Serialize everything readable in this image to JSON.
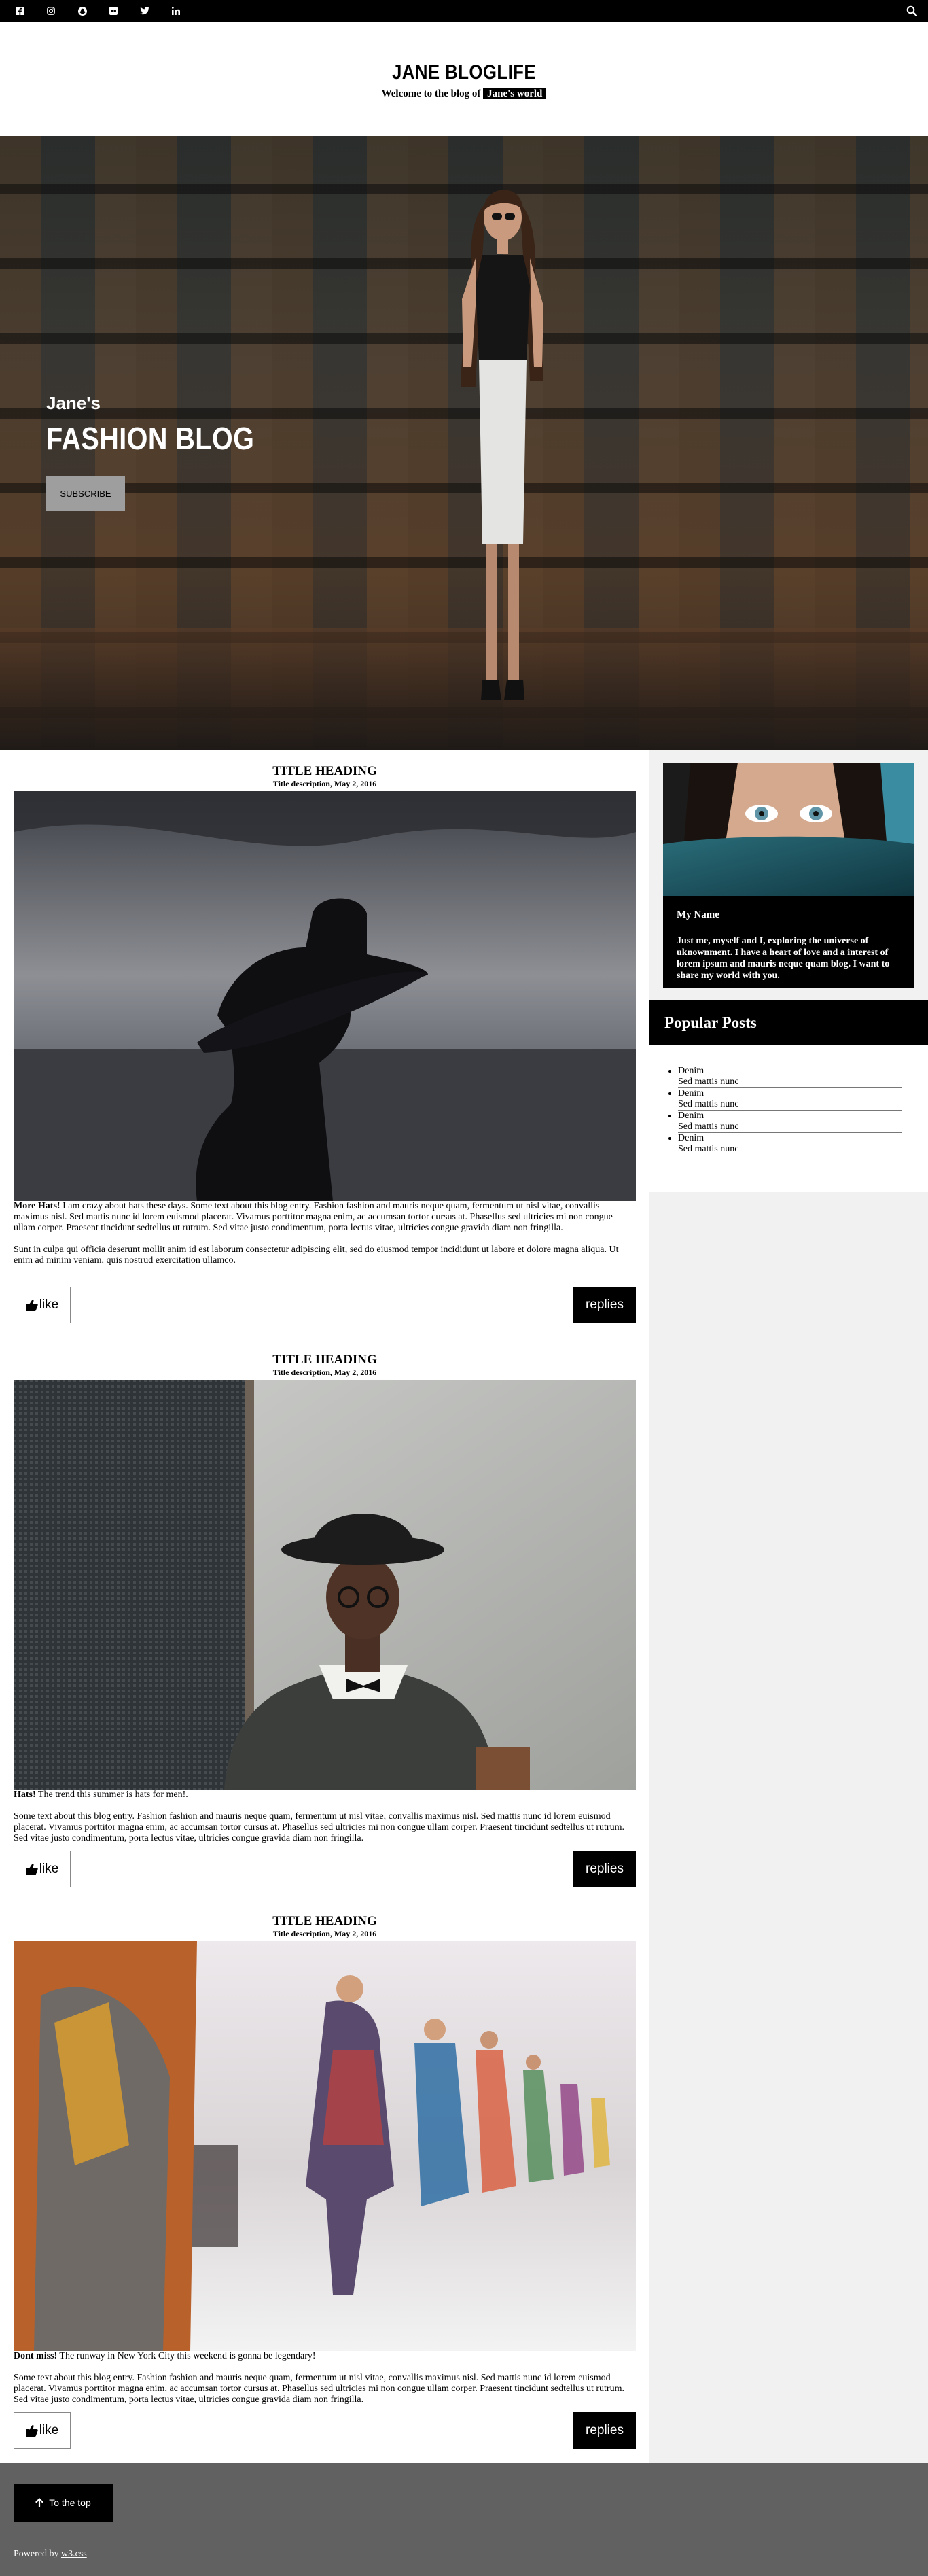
{
  "topbar": {
    "social_icons": [
      "facebook-icon",
      "instagram-icon",
      "snapchat-icon",
      "flickr-icon",
      "twitter-icon",
      "linkedin-icon"
    ],
    "search_icon": "search-icon"
  },
  "header": {
    "title": "JANE BLOGLIFE",
    "tagline_prefix": "Welcome to the blog of",
    "tagline_badge": "Jane's world"
  },
  "hero": {
    "subtitle": "Jane's",
    "title": "FASHION BLOG",
    "subscribe_label": "SUBSCRIBE"
  },
  "posts": [
    {
      "title": "TITLE HEADING",
      "date": "Title description, May 2, 2016",
      "lead_bold": "More Hats!",
      "lead_text": "I am crazy about hats these days. Some text about this blog entry. Fashion fashion and mauris neque quam, fermentum ut nisl vitae, convallis maximus nisl. Sed mattis nunc id lorem euismod placerat. Vivamus porttitor magna enim, ac accumsan tortor cursus at. Phasellus sed ultricies mi non congue ullam corper. Praesent tincidunt sedtellus ut rutrum. Sed vitae justo condimentum, porta lectus vitae, ultricies congue gravida diam non fringilla.",
      "body": "Sunt in culpa qui officia deserunt mollit anim id est laborum consectetur adipiscing elit, sed do eiusmod tempor incididunt ut labore et dolore magna aliqua. Ut enim ad minim veniam, quis nostrud exercitation ullamco.",
      "like_label": "like",
      "replies_label": "replies"
    },
    {
      "title": "TITLE HEADING",
      "date": "Title description, May 2, 2016",
      "lead_bold": "Hats!",
      "lead_text": "The trend this summer is hats for men!.",
      "body": "Some text about this blog entry. Fashion fashion and mauris neque quam, fermentum ut nisl vitae, convallis maximus nisl. Sed mattis nunc id lorem euismod placerat. Vivamus porttitor magna enim, ac accumsan tortor cursus at. Phasellus sed ultricies mi non congue ullam corper. Praesent tincidunt sedtellus ut rutrum. Sed vitae justo condimentum, porta lectus vitae, ultricies congue gravida diam non fringilla.",
      "like_label": "like",
      "replies_label": "replies"
    },
    {
      "title": "TITLE HEADING",
      "date": "Title description, May 2, 2016",
      "lead_bold": "Dont miss!",
      "lead_text": "The runway in New York City this weekend is gonna be legendary!",
      "body": "Some text about this blog entry. Fashion fashion and mauris neque quam, fermentum ut nisl vitae, convallis maximus nisl. Sed mattis nunc id lorem euismod placerat. Vivamus porttitor magna enim, ac accumsan tortor cursus at. Phasellus sed ultricies mi non congue ullam corper. Praesent tincidunt sedtellus ut rutrum. Sed vitae justo condimentum, porta lectus vitae, ultricies congue gravida diam non fringilla.",
      "like_label": "like",
      "replies_label": "replies"
    }
  ],
  "sidebar": {
    "profile_name": "My Name",
    "profile_bio": "Just me, myself and I, exploring the universe of uknownment. I have a heart of love and a interest of lorem ipsum and mauris neque quam blog. I want to share my world with you.",
    "popular_title": "Popular Posts",
    "popular_items": [
      {
        "title": "Denim",
        "sub": "Sed mattis nunc"
      },
      {
        "title": "Denim",
        "sub": "Sed mattis nunc"
      },
      {
        "title": "Denim",
        "sub": "Sed mattis nunc"
      },
      {
        "title": "Denim",
        "sub": "Sed mattis nunc"
      }
    ]
  },
  "footer": {
    "to_top_label": "To the top",
    "powered_prefix": "Powered by",
    "powered_link": "w3.css"
  }
}
